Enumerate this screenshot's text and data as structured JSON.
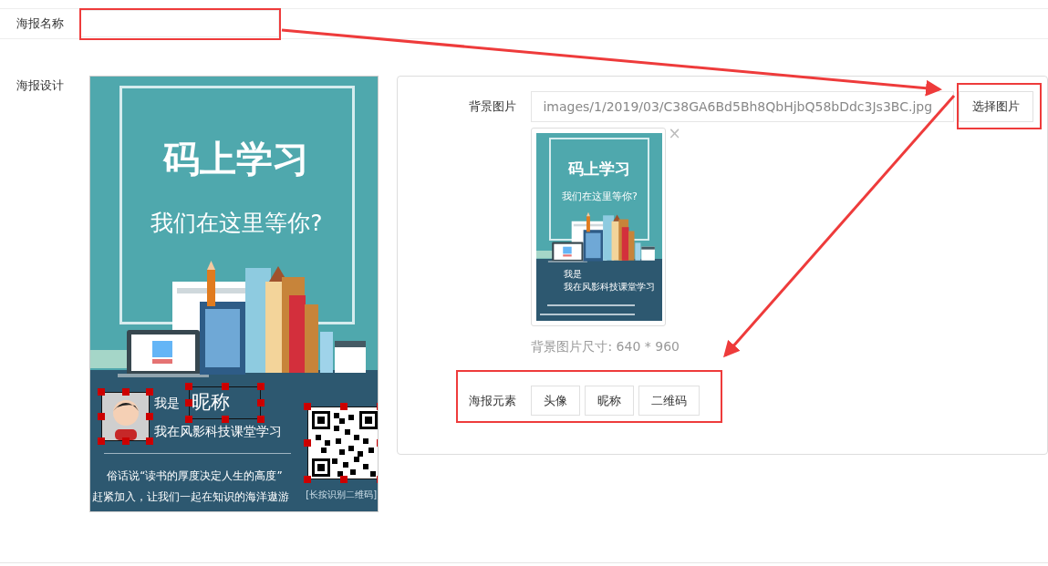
{
  "name_row": {
    "label": "海报名称"
  },
  "design_row": {
    "label": "海报设计"
  },
  "poster": {
    "title": "码上学习",
    "subtitle": "我们在这里等你?",
    "intro": "我是",
    "nickname": "昵称",
    "tagline": "我在风影科技课堂学习",
    "quote_lines": [
      "俗话说“读书的厚度决定人生的高度”",
      "赶紧加入，让我们一起在知识的海洋遨游"
    ],
    "qr_caption": "[长按识别二维码]"
  },
  "background": {
    "label": "背景图片",
    "value": "images/1/2019/03/C38GA6Bd5Bh8QbHjbQ58bDdc3Js3BC.jpg",
    "button": "选择图片",
    "remove": "×",
    "thumbnail": {
      "title": "码上学习",
      "subtitle": "我们在这里等你?",
      "intro": "我是",
      "tagline": "我在风影科技课堂学习"
    },
    "size_note": "背景图片尺寸: 640 * 960"
  },
  "elements": {
    "label": "海报元素",
    "buttons": [
      "头像",
      "昵称",
      "二维码"
    ]
  }
}
